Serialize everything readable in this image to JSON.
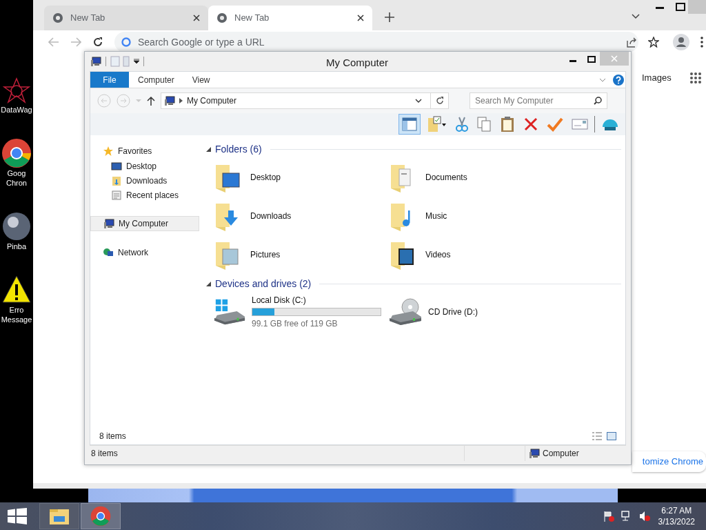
{
  "desktop_icons": [
    {
      "lines": [
        "DataWag"
      ]
    },
    {
      "lines": [
        "Goog",
        "Chron"
      ]
    },
    {
      "lines": [
        "Pinba"
      ]
    },
    {
      "lines": [
        "Erro",
        "Message"
      ]
    }
  ],
  "browser": {
    "tabs": [
      {
        "title": "New Tab",
        "selected": false
      },
      {
        "title": "New Tab",
        "selected": true
      }
    ],
    "omnibox": {
      "placeholder": "Search Google or type a URL"
    },
    "images_link": "Images",
    "customize_button": "tomize Chrome"
  },
  "explorer": {
    "title": "My Computer",
    "file_tab": "File",
    "ribbon_tabs": [
      {
        "label": "Computer",
        "selected": false
      },
      {
        "label": "View",
        "selected": false
      }
    ],
    "address": "My Computer",
    "search": {
      "placeholder": "Search My Computer"
    },
    "tools": [
      {
        "pressed": true
      },
      {
        "pressed": false
      },
      {
        "pressed": false
      },
      {
        "pressed": false
      },
      {
        "pressed": false
      },
      {
        "pressed": false
      },
      {
        "pressed": false
      },
      {
        "pressed": false
      },
      {
        "pressed": false
      }
    ],
    "nav": [
      {
        "label": "Favorites",
        "selected": false,
        "children": [
          {
            "label": "Desktop",
            "selected": false
          },
          {
            "label": "Downloads",
            "selected": false
          },
          {
            "label": "Recent places",
            "selected": false
          }
        ]
      },
      {
        "label": "My Computer",
        "selected": true
      },
      {
        "label": "Network",
        "selected": false
      }
    ],
    "sections": [
      {
        "title": "Folders (6)",
        "expanded": true,
        "items": [
          {
            "kind": "folder",
            "name": "Desktop"
          },
          {
            "kind": "folder",
            "name": "Documents"
          },
          {
            "kind": "folder",
            "name": "Downloads"
          },
          {
            "kind": "folder",
            "name": "Music"
          },
          {
            "kind": "folder",
            "name": "Pictures"
          },
          {
            "kind": "folder",
            "name": "Videos"
          }
        ]
      },
      {
        "title": "Devices and drives (2)",
        "expanded": true,
        "items": [
          {
            "kind": "disk",
            "name": "Local Disk (C:)",
            "level": 0.17,
            "free": "99.1 GB free of 119 GB"
          },
          {
            "kind": "cd",
            "name": "CD Drive (D:)"
          }
        ]
      }
    ],
    "item_count": "8 items",
    "status": {
      "count": "8 items",
      "location": "Computer"
    }
  },
  "taskbar": {
    "apps": [
      {
        "selected": false
      },
      {
        "selected": true
      }
    ],
    "time": "6:27 AM",
    "date": "3/13/2022"
  }
}
